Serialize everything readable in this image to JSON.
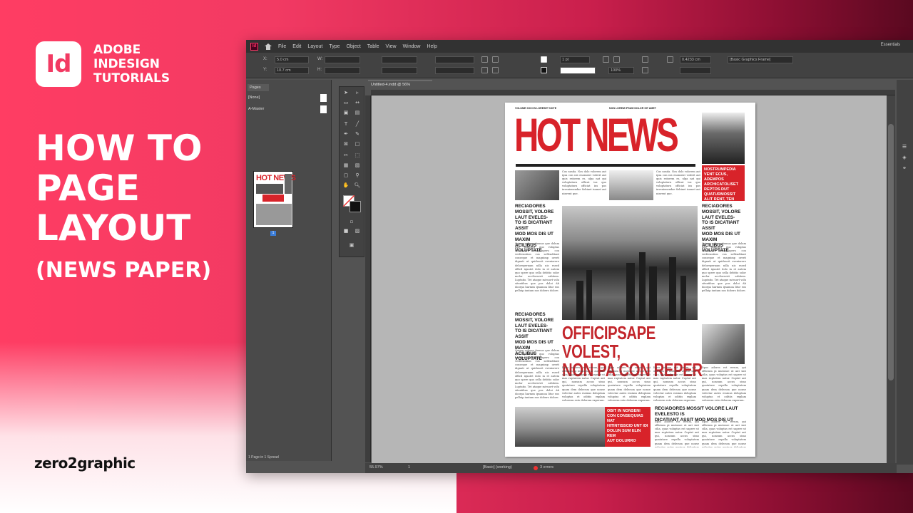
{
  "brand": {
    "logo_letters": "Id",
    "line1": "ADOBE",
    "line2": "INDESIGN",
    "line3": "TUTORIALS"
  },
  "headline": {
    "line1": "HOW TO",
    "line2": "PAGE",
    "line3": "LAYOUT",
    "sub": "(NEWS PAPER)"
  },
  "footer_brand": "zero2graphic",
  "app": {
    "badge": "Id",
    "menu": [
      "File",
      "Edit",
      "Layout",
      "Type",
      "Object",
      "Table",
      "View",
      "Window",
      "Help"
    ],
    "workspace": "Essentials",
    "control": {
      "x_label": "X:",
      "x_value": "5.0 cm",
      "y_label": "Y:",
      "y_value": "10.7 cm",
      "w_label": "W:",
      "h_label": "H:",
      "stroke_weight": "1 pt",
      "zoom_pct": "100%",
      "offset_value": "0.4233 cm",
      "object_style": "[Basic Graphics Frame]"
    },
    "pages_panel": {
      "tab": "Pages",
      "none_master": "[None]",
      "a_master": "A-Master",
      "page_number": "1",
      "status": "1 Page in 1 Spread"
    },
    "doc_tab": "Untitled-4.indd @ 56%",
    "status": {
      "zoom": "55.97%",
      "page": "1",
      "preflight": "[Basic] (working)",
      "errors": "3 errors"
    }
  },
  "newspaper": {
    "top_left": "VOLUME XXXI IN LORESET NOTE",
    "top_right": "NON LOREM IPSUM DOLOR SIT AMET",
    "masthead": "HOT NEWS",
    "thumb_title": "HOT NEWS",
    "sidebar_red": "NOSTRUMPEDIA VENT ECUS, ADEMPOS ARCHICATOLISET REPTOS DUT QUATURMOSSIT ALIT RENT, TEN MAGNM",
    "subhead_left_1": "RECIADORES MOSSIT, VOLORE LAUT EVELES-\nTO IS DICATIANT ASSIT\nMOD MOS DIS UT MAXIM\nACILIBUS VOLUPTATE",
    "subhead_left_2": "RECIADORES MOSSIT, VOLORE LAUT EVELES-\nTO IS DICATIANT ASSIT\nMOD MOS DIS UT MAXIM\nACILIBUS VOLUPTATE",
    "subhead_right_1": "RECIADORES MOSSIT, VOLORE LAUT EVELES-\nTO IS DICATIANT ASSIT\nMOD MOS DIS UT MAXIM\nACILIBUS VOLUPTATE",
    "feature": "OFFICIPSAPE VOLEST,\nNON PA CON REPER",
    "bottom_red": "OBIT IN NONSENI\nCON CONSEQUIAS NAT\nHITINTISSCID UNT IDI\nDOLUN SUM ELIN REM\nAUT DOLURRO",
    "bottom_subhead": "RECIADORES MOSSIT VOLORE LAUT EVELESTO IS\nDICATIANT ASSIT MOD MOS DIS UT",
    "body_short": "Cus nusda. Nos dolo volorem aut ipsa con nis enonsent volerit aut quis estorem es, ulpa nat qui voluptaturn officat ius quo voluptaturn officiat ius pos invenienendae Sebinet isomet aut ninvent que.",
    "body_long": "Quiam volores itemus que dolum que pelliores quo voluptas namdunt voluptasperu con verferuntion cus sollenditant conseque et magnimp orerit dignati ut quiduscit eveniorere delorepernam nilla nis essed officil iquatet dolo in et autem quo spere quo sella debitio solor molor accilorrovit arbitem. Luptatio. Tet ataque mi-mort volu siteatibus que pos doloi Ab doorpa harmus ipsamoa litur eos pelluip iuntam nos dobero dolore.",
    "body_bottom": "Itpos adores est rerum, qui officium pi mutonse ut aut sint cilia, quas voluptas est sapere ut mas ruptatem natur. Cuptat ant qui, nonsum accus simo quatature repella voluptatem quam dem delecum que nonse volectur autes essinus doluptam voluptas et oditiis explam volorerm esto dolorem experum."
  }
}
